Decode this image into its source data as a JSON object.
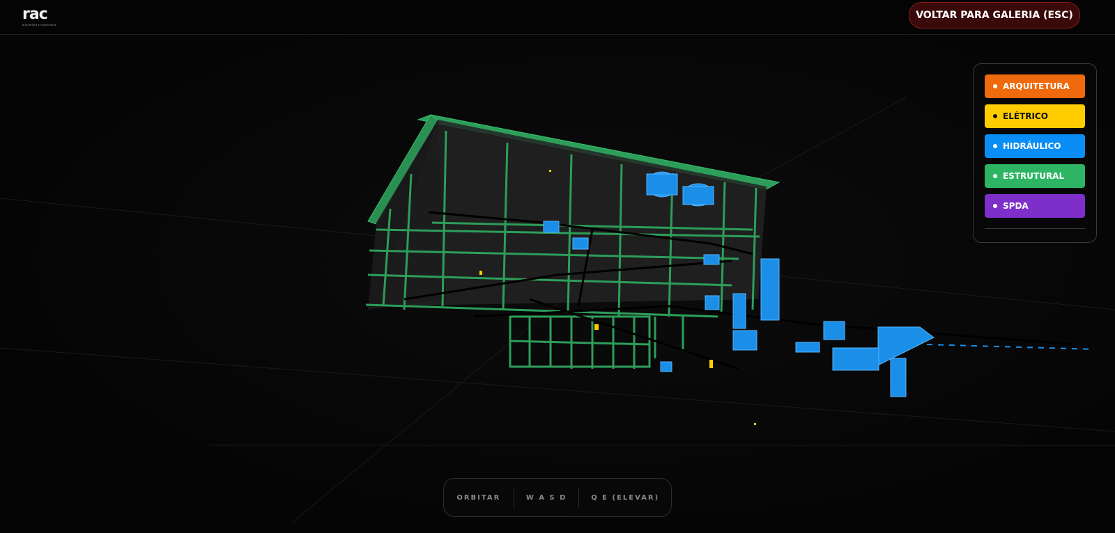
{
  "header": {
    "logo_text": "rac",
    "logo_subtitle": "arquitetura e engenharia",
    "back_button_label": "VOLTAR PARA GALERIA (ESC)"
  },
  "layers": [
    {
      "label": "ARQUITETURA",
      "color": "#ee6a0c",
      "text_color": "#ffffff"
    },
    {
      "label": "ELÉTRICO",
      "color": "#ffcc00",
      "text_color": "#111111"
    },
    {
      "label": "HIDRÁULICO",
      "color": "#0a8ef5",
      "text_color": "#ffffff"
    },
    {
      "label": "ESTRUTURAL",
      "color": "#2db563",
      "text_color": "#ffffff"
    },
    {
      "label": "SPDA",
      "color": "#7e2fc9",
      "text_color": "#ffffff"
    }
  ],
  "controls": {
    "orbit": "ORBITAR",
    "move": "W A S D",
    "elevate": "Q E (ELEVAR)"
  },
  "colors": {
    "structure": "#2d9e5a",
    "hydraulic": "#1b8fe8",
    "electric": "#ffcc00",
    "back_button_border": "#8a1a1a"
  },
  "icons": {
    "layer_bullet": "dot-icon"
  }
}
